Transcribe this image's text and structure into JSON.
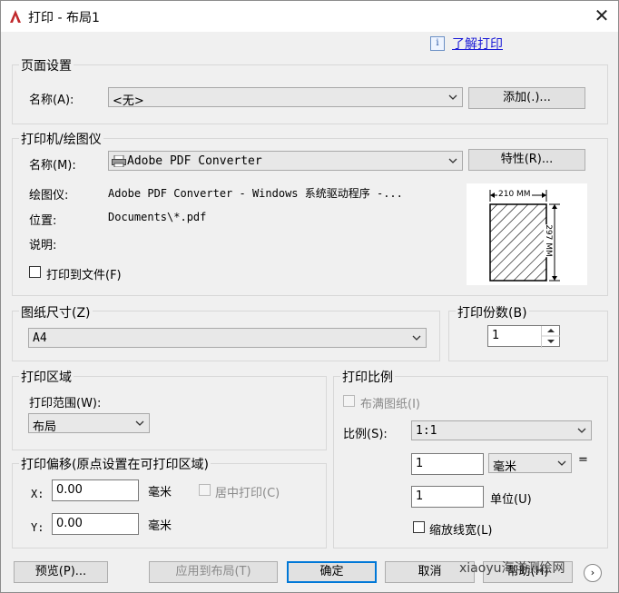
{
  "window": {
    "title": "打印 - 布局1",
    "help_link": "了解打印",
    "info_icon": "i"
  },
  "page_setup": {
    "group_title": "页面设置",
    "name_label": "名称(A):",
    "name_value": "<无>",
    "add_button": "添加(.)..."
  },
  "printer": {
    "group_title": "打印机/绘图仪",
    "name_label": "名称(M):",
    "name_value": "Adobe PDF Converter",
    "properties_button": "特性(R)...",
    "plotter_label": "绘图仪:",
    "plotter_value": "Adobe PDF Converter - Windows 系统驱动程序 -...",
    "location_label": "位置:",
    "location_value": "Documents\\*.pdf",
    "description_label": "说明:",
    "print_to_file_label": "打印到文件(F)",
    "paper_width_label": "210 MM",
    "paper_height_label": "297 MM"
  },
  "paper_size": {
    "group_title": "图纸尺寸(Z)",
    "value": "A4"
  },
  "copies": {
    "group_title": "打印份数(B)",
    "value": "1"
  },
  "plot_area": {
    "group_title": "打印区域",
    "range_label": "打印范围(W):",
    "range_value": "布局"
  },
  "plot_offset": {
    "group_title": "打印偏移(原点设置在可打印区域)",
    "x_label": "X:",
    "x_value": "0.00",
    "x_unit": "毫米",
    "y_label": "Y:",
    "y_value": "0.00",
    "y_unit": "毫米",
    "center_label": "居中打印(C)"
  },
  "plot_scale": {
    "group_title": "打印比例",
    "fit_label": "布满图纸(I)",
    "scale_label": "比例(S):",
    "scale_value": "1:1",
    "value1": "1",
    "unit_value": "毫米",
    "equals": "=",
    "value2": "1",
    "unit_label": "单位(U)",
    "lineweight_label": "缩放线宽(L)"
  },
  "buttons": {
    "preview": "预览(P)...",
    "apply_to_layout": "应用到布局(T)",
    "ok": "确定",
    "cancel": "取消",
    "help": "帮助(H)"
  },
  "watermark": "xiaoyu海洋测绘网",
  "colors": {
    "link": "#1b1bd6",
    "primary_border": "#0078d7",
    "app_icon": "#c0282b"
  }
}
